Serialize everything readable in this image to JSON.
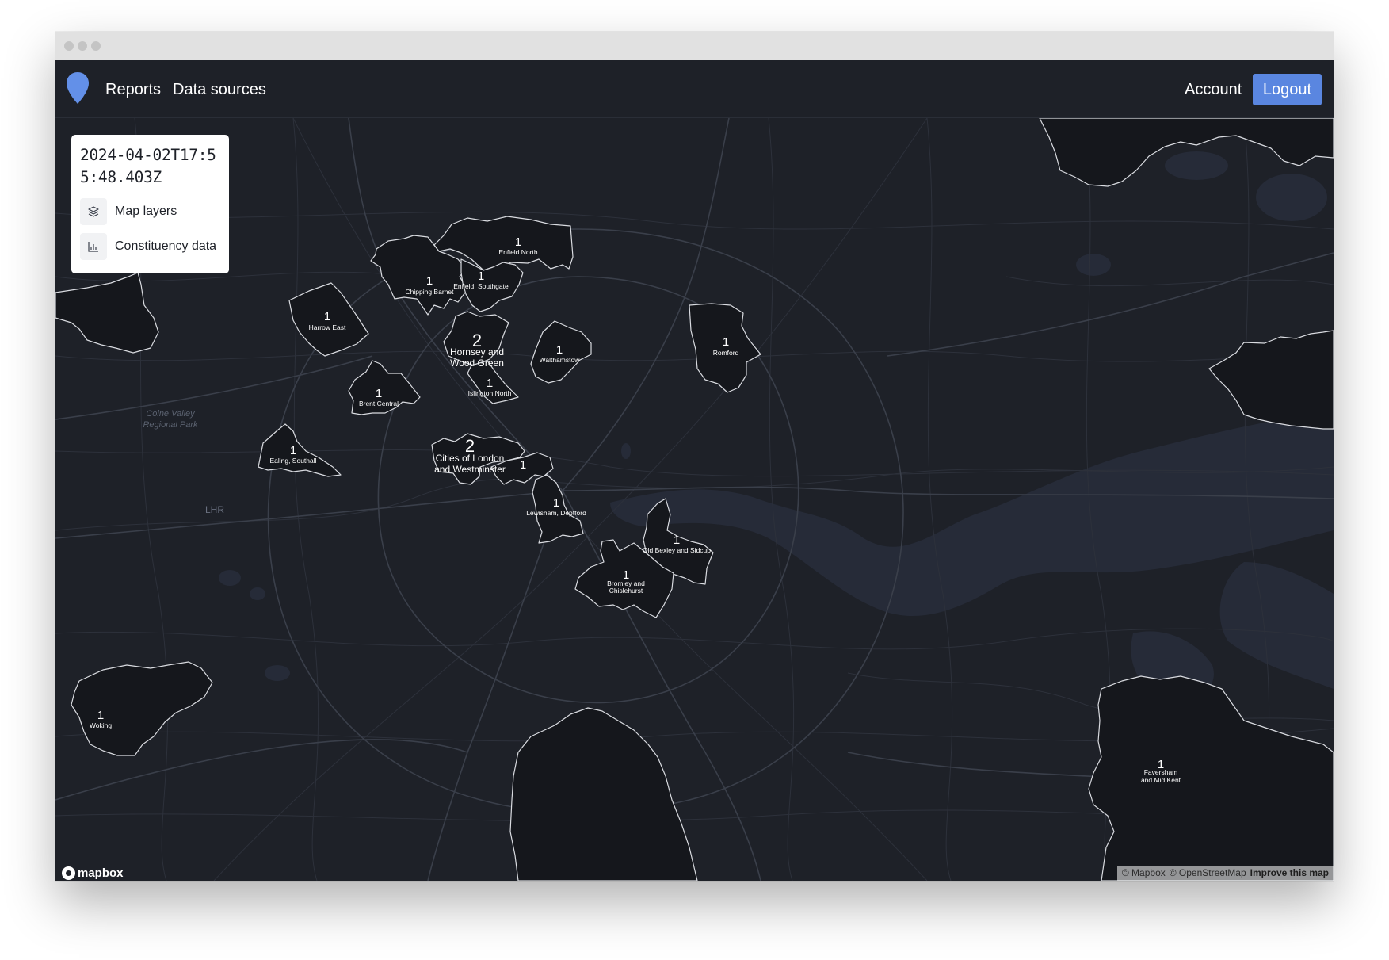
{
  "nav": {
    "reports": "Reports",
    "data_sources": "Data sources",
    "account": "Account",
    "logout": "Logout",
    "accent_color": "#5a86e0",
    "logo_icon": "map-pin-icon"
  },
  "panel": {
    "title": "2024-04-02T17:55:48.403Z",
    "items": [
      {
        "label": "Map layers",
        "icon": "layers-icon"
      },
      {
        "label": "Constituency data",
        "icon": "bar-chart-icon"
      }
    ]
  },
  "map": {
    "constituencies": [
      {
        "count": "1",
        "name": "Enfield North"
      },
      {
        "count": "1",
        "name": "Chipping Barnet"
      },
      {
        "count": "1",
        "name": "Enfield, Southgate"
      },
      {
        "count": "1",
        "name": "Harrow East"
      },
      {
        "count": "2",
        "name": "Hornsey and Wood Green"
      },
      {
        "count": "1",
        "name": "Walthamstow"
      },
      {
        "count": "1",
        "name": "Romford"
      },
      {
        "count": "1",
        "name": "Islington North"
      },
      {
        "count": "1",
        "name": "Brent Central"
      },
      {
        "count": "2",
        "name": "Cities of London and Westminster"
      },
      {
        "count": "1",
        "name": ""
      },
      {
        "count": "1",
        "name": "Ealing, Southall"
      },
      {
        "count": "1",
        "name": "Lewisham, Deptford"
      },
      {
        "count": "1",
        "name": "Old Bexley and Sidcup"
      },
      {
        "count": "1",
        "name": "Bromley and Chislehurst"
      },
      {
        "count": "1",
        "name": "Woking"
      },
      {
        "count": "1",
        "name": "Faversham and Mid Kent"
      }
    ],
    "places": {
      "lhr": "LHR",
      "colne_valley": "Colne Valley Regional Park"
    },
    "attribution": {
      "mapbox": "© Mapbox",
      "osm": "© OpenStreetMap",
      "improve": "Improve this map"
    },
    "mapbox_logo": "mapbox",
    "colors": {
      "background": "#1e2128",
      "water": "#272c3a",
      "constituency_fill": "#15171c",
      "constituency_outline": "#d9dbe0"
    }
  }
}
